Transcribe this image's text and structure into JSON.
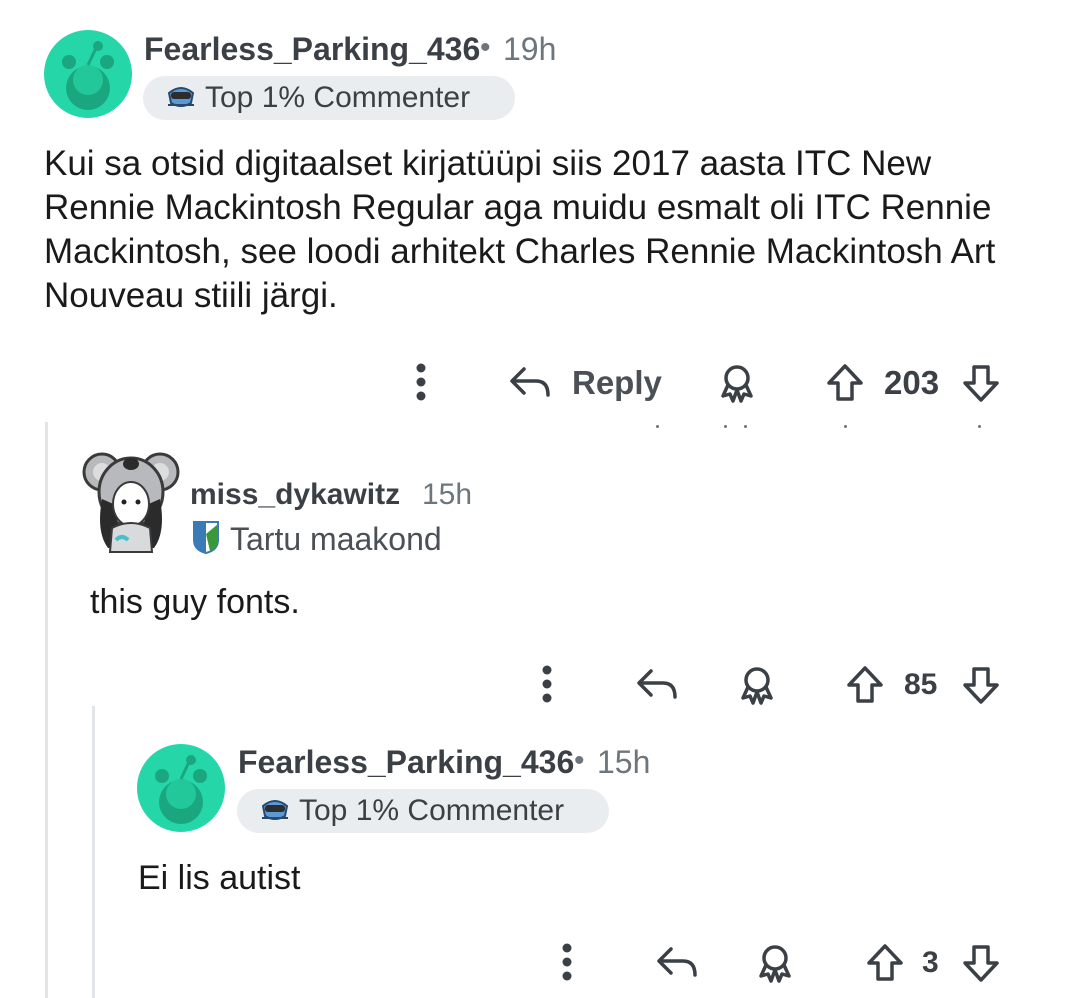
{
  "colors": {
    "avatar_teal": "#24d6a8",
    "text_primary": "#1a1a1b",
    "text_meta": "#6e767d",
    "flair_bg": "#eaedef",
    "thread_line": "#e2e5e8"
  },
  "comments": [
    {
      "username": "Fearless_Parking_436",
      "separator": "•",
      "time": "19h",
      "flair": {
        "icon": "top-commenter-icon",
        "label": "Top 1% Commenter"
      },
      "body": "Kui sa otsid digitaalset kirjatüüpi siis 2017 aasta ITC New Rennie Mackintosh Regular aga muidu esmalt oli ITC Rennie Mackintosh, see loodi arhitekt Charles Rennie Mackintosh Art Nouveau stiili järgi.",
      "actions": {
        "reply_label": "Reply",
        "score": "203"
      }
    },
    {
      "username": "miss_dykawitz",
      "time": "15h",
      "flair": {
        "icon": "tartu-county-flag-icon",
        "label": "Tartu maakond"
      },
      "body": "this guy fonts.",
      "actions": {
        "score": "85"
      }
    },
    {
      "username": "Fearless_Parking_436",
      "separator": "•",
      "time": "15h",
      "flair": {
        "icon": "top-commenter-icon",
        "label": "Top 1% Commenter"
      },
      "body": "Ei lis autist",
      "actions": {
        "score": "3"
      }
    }
  ]
}
